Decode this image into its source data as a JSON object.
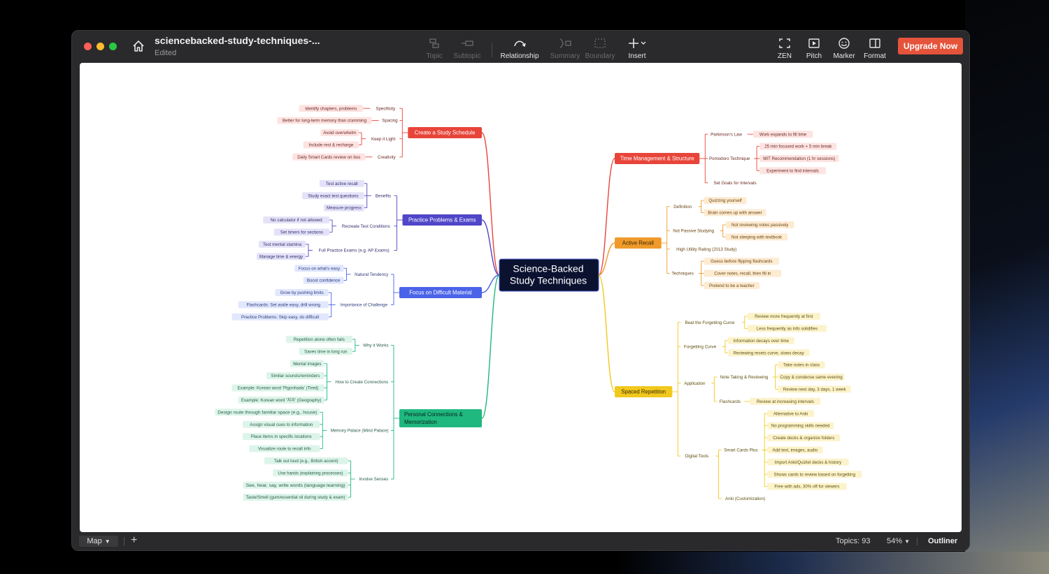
{
  "window": {
    "title": "sciencebacked-study-techniques-...",
    "status": "Edited",
    "upgrade_label": "Upgrade Now"
  },
  "toolbar": {
    "items": [
      {
        "label": "Topic",
        "icon": "topic-icon",
        "enabled": false
      },
      {
        "label": "Subtopic",
        "icon": "subtopic-icon",
        "enabled": false
      },
      {
        "label": "Relationship",
        "icon": "relationship-icon",
        "enabled": true
      },
      {
        "label": "Summary",
        "icon": "summary-icon",
        "enabled": false
      },
      {
        "label": "Boundary",
        "icon": "boundary-icon",
        "enabled": false
      },
      {
        "label": "Insert",
        "icon": "plus-icon",
        "enabled": true
      }
    ],
    "right_items": [
      {
        "label": "ZEN",
        "icon": "zen-icon"
      },
      {
        "label": "Pitch",
        "icon": "pitch-icon"
      },
      {
        "label": "Marker",
        "icon": "smiley-icon"
      },
      {
        "label": "Format",
        "icon": "format-panel-icon"
      }
    ]
  },
  "bottom_bar": {
    "view": "Map",
    "topics_label": "Topics: 93",
    "zoom": "54%",
    "outliner_label": "Outliner"
  },
  "colors": {
    "red": "#e8443a",
    "indigo": "#5046c8",
    "blue": "#4a63e8",
    "green": "#1fb87f",
    "orange": "#f09a2b",
    "yellow": "#f1c81d"
  },
  "mindmap": {
    "central": [
      "Science-Backed",
      "Study Techniques"
    ],
    "left": [
      {
        "label": "Create a Study Schedule",
        "color": "red",
        "subs": [
          {
            "label": "Specificity",
            "leaves": [
              "Identify chapters, problems"
            ]
          },
          {
            "label": "Spacing",
            "leaves": [
              "Better for long-term memory than cramming"
            ]
          },
          {
            "label": "Keep it Light",
            "leaves": [
              "Avoid overwhelm",
              "Include rest & recharge"
            ]
          },
          {
            "label": "Creativity",
            "leaves": [
              "Daily Smart Cards review on bus"
            ]
          }
        ]
      },
      {
        "label": "Practice Problems & Exams",
        "color": "indigo",
        "subs": [
          {
            "label": "Benefits",
            "leaves": [
              "Test active recall",
              "Study exact test questions",
              "Measure progress"
            ]
          },
          {
            "label": "Recreate Test Conditions",
            "leaves": [
              "No calculator if not allowed",
              "Set timers for sections"
            ]
          },
          {
            "label": "Full Practice Exams (e.g. AP Exams)",
            "leaves": [
              "Test mental stamina",
              "Manage time & energy"
            ]
          }
        ]
      },
      {
        "label": "Focus on Difficult Material",
        "color": "blue",
        "subs": [
          {
            "label": "Natural Tendency",
            "leaves": [
              "Focus on what's easy",
              "Boost confidence"
            ]
          },
          {
            "label": "Importance of Challenge",
            "leaves": [
              "Grow by pushing limits",
              "Flashcards: Set aside easy, drill wrong",
              "Practice Problems: Skip easy, do difficult"
            ]
          }
        ]
      },
      {
        "label": "Personal Connections & Memorization",
        "color": "green",
        "subs": [
          {
            "label": "Why it Works",
            "leaves": [
              "Repetition alone often fails",
              "Saves time in long run"
            ]
          },
          {
            "label": "How to Create Connections",
            "leaves": [
              "Mental images",
              "Similar sounds/reminders",
              "Example: Korean word 'Pigonhada' (Tired)",
              "Example: Korean word '지리' (Geography)"
            ]
          },
          {
            "label": "Memory Palace (Mind Palace)",
            "leaves": [
              "Design route through familiar space (e.g., house)",
              "Assign visual cues to information",
              "Place items in specific locations",
              "Visualize route to recall info"
            ]
          },
          {
            "label": "Involve Senses",
            "leaves": [
              "Talk out loud (e.g., British accent)",
              "Use hands (explaining processes)",
              "See, hear, say, write words (language learning)",
              "Taste/Smell (gum/essential oil during study & exam)"
            ]
          }
        ]
      }
    ],
    "right": [
      {
        "label": "Time Management & Structure",
        "color": "red",
        "subs": [
          {
            "label": "Parkinson's Law",
            "leaves": [
              "Work expands to fill time"
            ]
          },
          {
            "label": "Pomodoro Technique",
            "leaves": [
              "25 min focused work + 5 min break",
              "MIT Recommendation (1 hr sessions)",
              "Experiment to find intervals"
            ]
          },
          {
            "label": "Set Goals for Intervals",
            "leaves": []
          }
        ]
      },
      {
        "label": "Active Recall",
        "color": "orange",
        "subs": [
          {
            "label": "Definition",
            "leaves": [
              "Quizzing yourself",
              "Brain comes up with answer"
            ]
          },
          {
            "label": "Not Passive Studying",
            "leaves": [
              "Not reviewing notes passively",
              "Not sleeping with textbook"
            ]
          },
          {
            "label": "High Utility Rating (2013 Study)",
            "leaves": []
          },
          {
            "label": "Techniques",
            "leaves": [
              "Guess before flipping flashcards",
              "Cover notes, recall, then fill in",
              "Pretend to be a teacher"
            ]
          }
        ]
      },
      {
        "label": "Spaced Repetition",
        "color": "yellow",
        "subs": [
          {
            "label": "Beat the Forgetting Curve",
            "leaves": [
              "Review more frequently at first",
              "Less frequently as info solidifies"
            ]
          },
          {
            "label": "Forgetting Curve",
            "leaves": [
              "Information decays over time",
              "Reviewing resets curve, slows decay"
            ]
          },
          {
            "label": "Application",
            "groups": [
              {
                "label": "Note Taking & Reviewing",
                "leaves": [
                  "Take notes in class",
                  "Copy & condense same evening",
                  "Review next day, 3 days, 1 week"
                ]
              },
              {
                "label": "Flashcards",
                "leaves": [
                  "Review at increasing intervals"
                ]
              }
            ]
          },
          {
            "label": "Digital Tools",
            "groups": [
              {
                "label": "Smart Cards Plus",
                "leaves": [
                  "Alternative to Anki",
                  "No programming skills needed",
                  "Create decks & organize folders",
                  "Add text, images, audio",
                  "Import Anki/Quizlet decks & history",
                  "Shows cards to review based on forgetting",
                  "Free with ads, 30% off for viewers"
                ]
              },
              {
                "label": "Anki (Customization)",
                "leaves": []
              }
            ]
          }
        ]
      }
    ]
  }
}
